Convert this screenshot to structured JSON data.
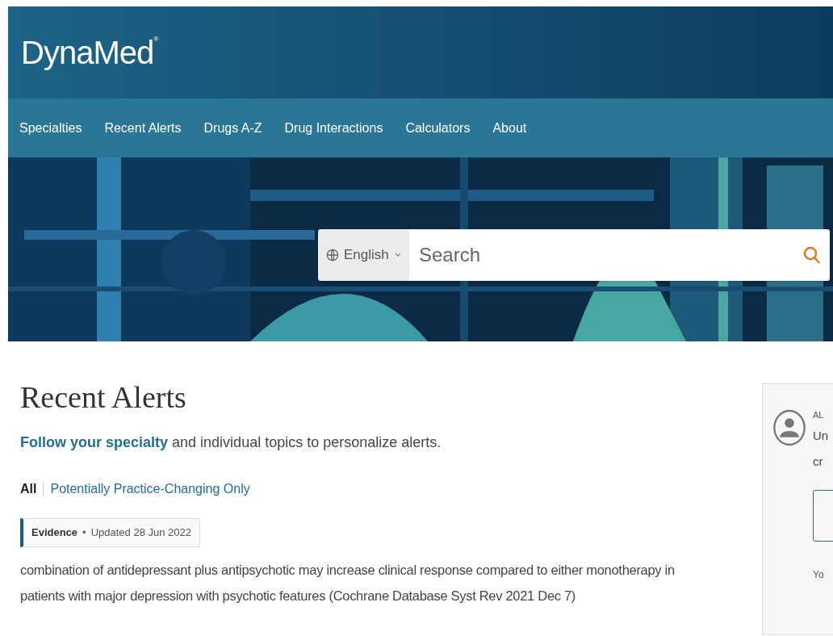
{
  "brand": {
    "name": "DynaMed",
    "mark": "®"
  },
  "nav": [
    {
      "label": "Specialties",
      "selected": false
    },
    {
      "label": "Recent Alerts",
      "selected": false
    },
    {
      "label": "Drugs A-Z",
      "selected": false
    },
    {
      "label": "Drug Interactions",
      "selected": false
    },
    {
      "label": "Calculators",
      "selected": false
    },
    {
      "label": "About",
      "selected": false
    }
  ],
  "search": {
    "language": "English",
    "placeholder": "Search"
  },
  "page": {
    "title": "Recent Alerts",
    "intro_link": "Follow your specialty",
    "intro_text": "and individual topics to personalize alerts."
  },
  "filters": [
    {
      "label": "All",
      "selected": true
    },
    {
      "label": "Potentially Practice-Changing Only",
      "selected": false
    }
  ],
  "alert": {
    "type": "Evidence",
    "separator": "•",
    "updated": "Updated 28 Jun 2022",
    "lines": [
      "combination of antidepressant plus antipsychotic may increase clinical response compared to either monotherapy in",
      "patients with major depression with psychotic features (Cochrane Database Syst Rev 2021 Dec 7)"
    ]
  },
  "side_card": {
    "heading": "AL",
    "text_lines": [
      "Un",
      "cr"
    ],
    "footer": "Yo"
  }
}
